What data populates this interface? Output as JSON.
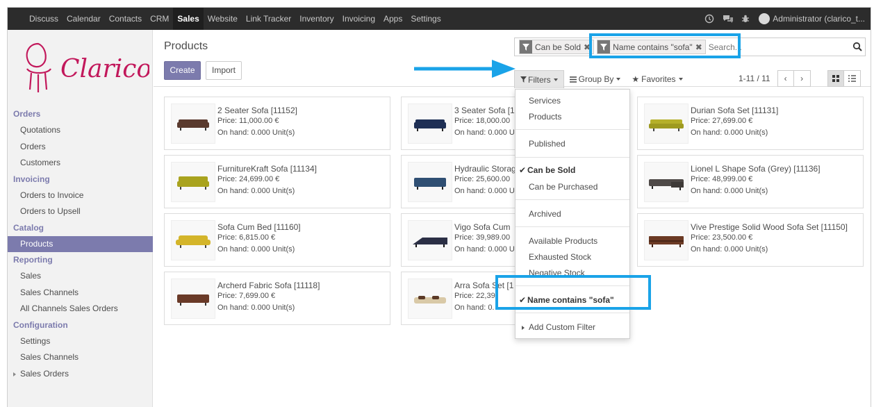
{
  "topbar": {
    "apps": [
      "Discuss",
      "Calendar",
      "Contacts",
      "CRM",
      "Sales",
      "Website",
      "Link Tracker",
      "Inventory",
      "Invoicing",
      "Apps",
      "Settings"
    ],
    "active_app": "Sales",
    "user": "Administrator (clarico_t..."
  },
  "logo": {
    "text": "Clarico",
    "color": "#c2185b"
  },
  "sidebar": {
    "sections": [
      {
        "title": "Orders",
        "items": [
          "Quotations",
          "Orders",
          "Customers"
        ]
      },
      {
        "title": "Invoicing",
        "items": [
          "Orders to Invoice",
          "Orders to Upsell"
        ]
      },
      {
        "title": "Catalog",
        "items": [
          "Products"
        ]
      },
      {
        "title": "Reporting",
        "items": [
          "Sales",
          "Sales Channels",
          "All Channels Sales Orders"
        ]
      },
      {
        "title": "Configuration",
        "items": [
          "Settings",
          "Sales Channels",
          "Sales Orders"
        ]
      }
    ],
    "active_item": "Products"
  },
  "control_panel": {
    "breadcrumb": "Products",
    "create_label": "Create",
    "import_label": "Import",
    "facets": [
      "Can be Sold",
      "Name contains \"sofa\""
    ],
    "search_placeholder": "Search...",
    "filters_label": "Filters",
    "groupby_label": "Group By",
    "favorites_label": "Favorites",
    "pager": "1-11 / 11",
    "pager_prev": "‹",
    "pager_next": "›"
  },
  "filters_menu": {
    "groups": [
      [
        "Services",
        "Products"
      ],
      [
        "Published"
      ],
      [
        "Can be Sold",
        "Can be Purchased"
      ],
      [
        "Archived"
      ],
      [
        "Available Products",
        "Exhausted Stock",
        "Negative Stock"
      ],
      [
        "Name contains \"sofa\""
      ]
    ],
    "checked": [
      "Can be Sold",
      "Name contains \"sofa\""
    ],
    "add_custom": "Add Custom Filter"
  },
  "products": [
    {
      "name": "2 Seater Sofa [11152]",
      "price": "Price: 11,000.00 €",
      "onhand": "On hand: 0.000 Unit(s)",
      "color": "#5a3a2e"
    },
    {
      "name": "3 Seater Sofa [1",
      "price": "Price: 18,000.00",
      "onhand": "On hand: 0.000 U",
      "color": "#1e2f55"
    },
    {
      "name": "Durian Sofa Set [11131]",
      "price": "Price: 27,699.00 €",
      "onhand": "On hand: 0.000 Unit(s)",
      "color": "#b5b02a"
    },
    {
      "name": "FurnitureKraft Sofa [11134]",
      "price": "Price: 24,699.00 €",
      "onhand": "On hand: 0.000 Unit(s)",
      "color": "#a9a31e"
    },
    {
      "name": "Hydraulic Storag",
      "price": "Price: 25,600.00",
      "onhand": "On hand: 0.000 U",
      "color": "#2f4f73"
    },
    {
      "name": "Lionel L Shape Sofa (Grey) [11136]",
      "price": "Price: 48,999.00 €",
      "onhand": "On hand: 0.000 Unit(s)",
      "color": "#4f4a48"
    },
    {
      "name": "Sofa Cum Bed [11160]",
      "price": "Price: 6,815.00 €",
      "onhand": "On hand: 0.000 Unit(s)",
      "color": "#d4b52a"
    },
    {
      "name": "Vigo Sofa Cum",
      "price": "Price: 39,989.00",
      "onhand": "On hand: 0.000 U",
      "color": "#2b2f45"
    },
    {
      "name": "Vive Prestige Solid Wood Sofa Set [11150]",
      "price": "Price: 23,500.00 €",
      "onhand": "On hand: 0.000 Unit(s)",
      "color": "#6b3a24"
    },
    {
      "name": "Archerd Fabric Sofa [11118]",
      "price": "Price: 7,699.00 €",
      "onhand": "On hand: 0.000 Unit(s)",
      "color": "#6a3a28"
    },
    {
      "name": "Arra Sofa Set [1",
      "price": "Price: 22,39",
      "onhand": "On hand: 0.",
      "color": "#d9c9a7"
    }
  ],
  "annotation_color": "#1aa3e8"
}
